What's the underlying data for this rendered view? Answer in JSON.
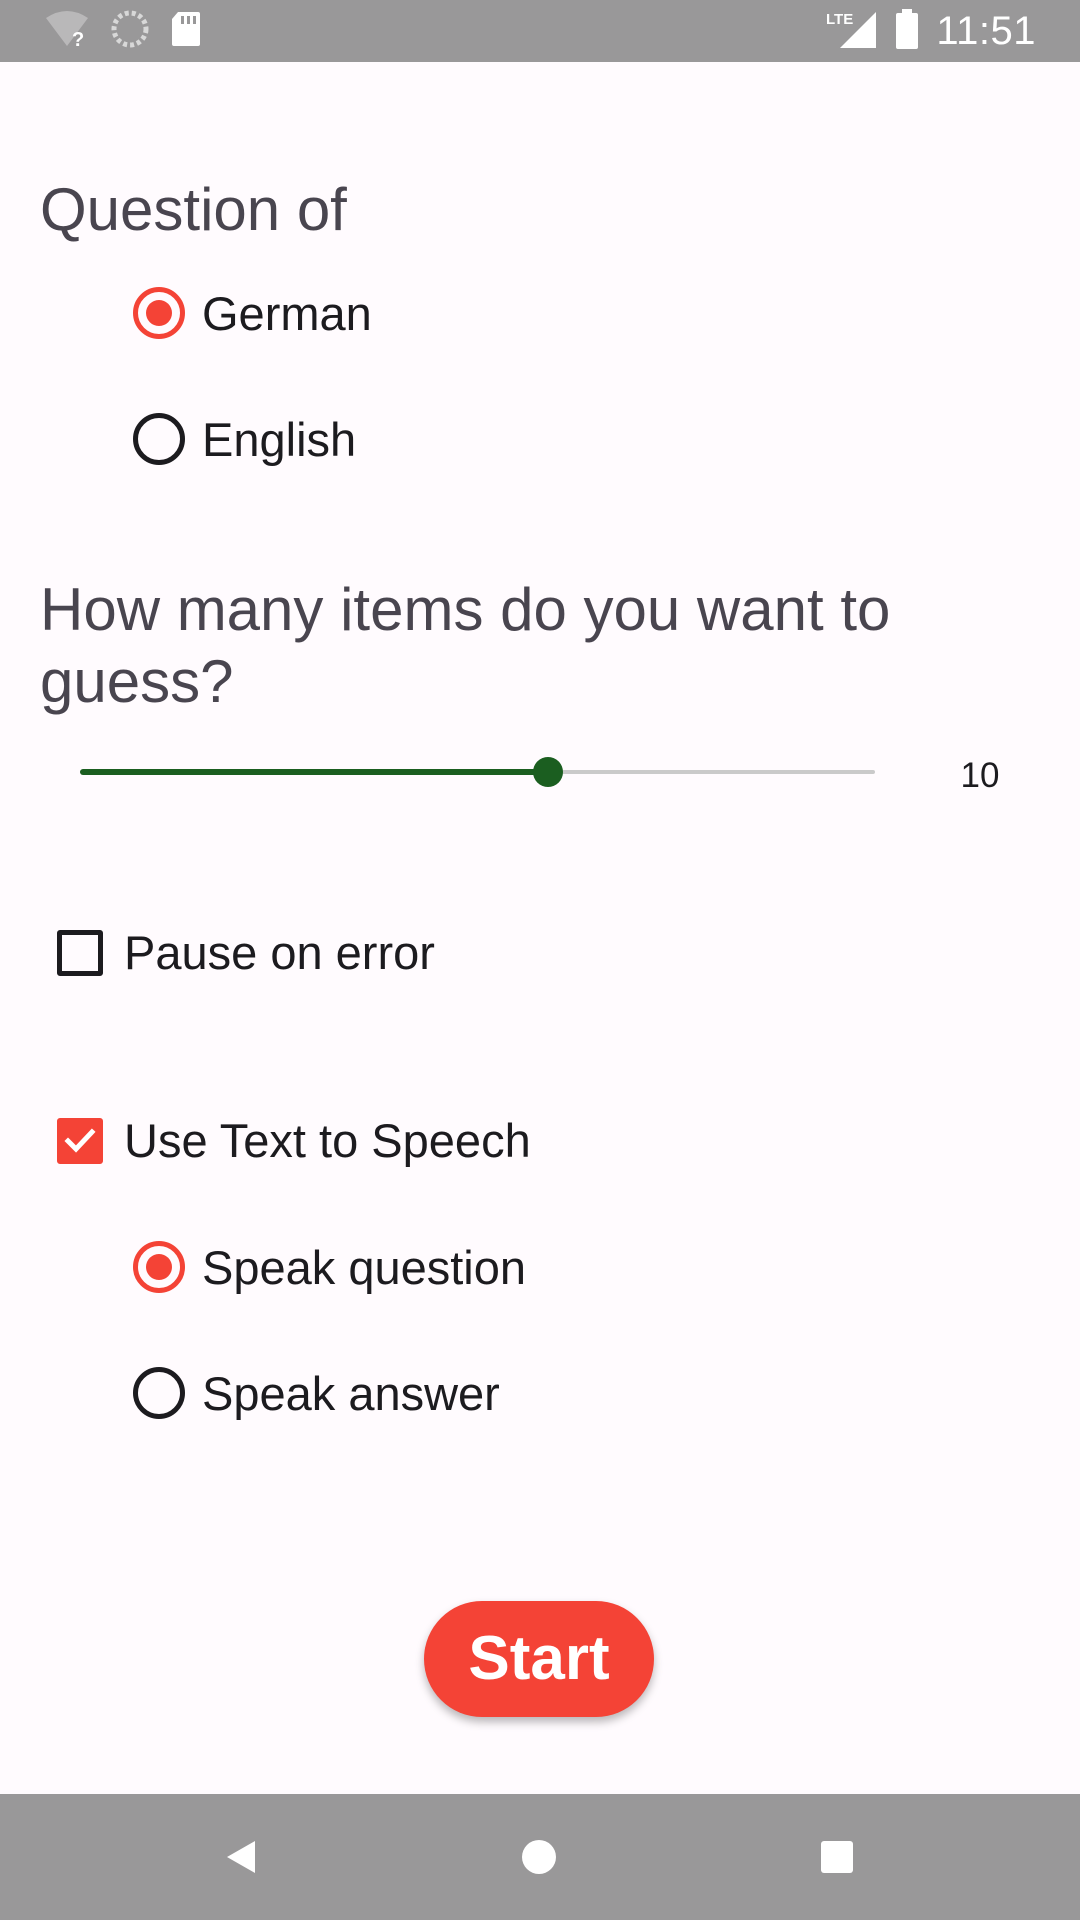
{
  "status_bar": {
    "time": "11:51",
    "network": "LTE",
    "icons": [
      "wifi-unknown-icon",
      "sync-icon",
      "sd-card-icon",
      "lte-signal-icon",
      "battery-icon"
    ]
  },
  "question_of": {
    "title": "Question of",
    "options": [
      {
        "label": "German",
        "selected": true
      },
      {
        "label": "English",
        "selected": false
      }
    ]
  },
  "items_count": {
    "title": "How many items do you want to guess?",
    "value": "10",
    "slider_fraction": 0.589
  },
  "pause_on_error": {
    "label": "Pause on error",
    "checked": false
  },
  "text_to_speech": {
    "label": "Use Text to Speech",
    "checked": true,
    "options": [
      {
        "label": "Speak question",
        "selected": true
      },
      {
        "label": "Speak answer",
        "selected": false
      }
    ]
  },
  "start_button": {
    "label": "Start"
  },
  "nav_bar": {
    "icons": [
      "back-icon",
      "home-icon",
      "recents-icon"
    ]
  },
  "colors": {
    "accent": "#F44336",
    "slider": "#1B5E20",
    "system_bars": "#999899",
    "background": "#FFFBFE"
  }
}
